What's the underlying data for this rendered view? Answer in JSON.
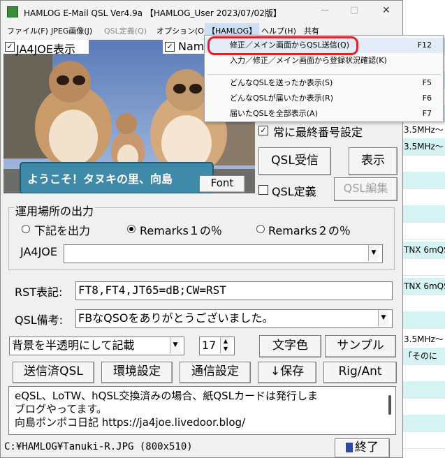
{
  "window": {
    "title": "HAMLOG E-Mail QSL Ver4.9a 【HAMLOG_User 2023/07/02版】",
    "minimize": "—",
    "maximize": "▢",
    "close": "✕"
  },
  "menubar": [
    "ファイル(F)",
    "JPEG画像(J)",
    "QSL定義(Q)",
    "オプション(O)",
    "【HAMLOG】",
    "ヘルプ(H)",
    "共有"
  ],
  "dropdown": {
    "items": [
      {
        "label": "修正／メイン画面からQSL送信(Q)",
        "key": "F12"
      },
      {
        "label": "入力／修正／メイン画面から登録状況確認(K)",
        "key": ""
      },
      {
        "label": "どんなQSLを送ったか表示(S)",
        "key": "F5"
      },
      {
        "label": "どんなQSLが届いたか表示(R)",
        "key": "F6"
      },
      {
        "label": "届いたQSLを全部表示(A)",
        "key": "F7"
      }
    ]
  },
  "image_area": {
    "chk_callsign": "JA4JOE表示",
    "chk_name": "Name",
    "sign_text": "ようこそ！タヌキの里、向島",
    "font_button": "Font"
  },
  "right_panel": {
    "chk_last_number": "常に最終番号設定",
    "btn_receive": "QSL受信",
    "btn_show": "表示",
    "chk_qsl_def": "QSL定義",
    "btn_qsl_edit": "QSL編集"
  },
  "output_group": {
    "title": "運用場所の出力",
    "radio1": "下記を出力",
    "radio2": "Remarks１の％",
    "radio3": "Remarks２の％",
    "call_label": "JA4JOE",
    "call_value": ""
  },
  "rst": {
    "label": "RST表記:",
    "value": "FT8,FT4,JT65=dB;CW=RST"
  },
  "remarks": {
    "label": "QSL備考:",
    "value": "FBなQSOをありがとうございました。"
  },
  "bg_select": {
    "value": "背景を半透明にして記載"
  },
  "font_size": {
    "value": "17"
  },
  "buttons": {
    "char_color": "文字色",
    "sample": "サンプル",
    "sent_qsl": "送信済QSL",
    "env": "環境設定",
    "comm": "通信設定",
    "save": "↓保存",
    "rigant": "Rig/Ant",
    "exit": "終了"
  },
  "memo": {
    "line1": "eQSL、LoTW、hQSL交換済みの場合、紙QSLカードは発行しま",
    "line2": "ブログやってます。",
    "line3": "向島ポンポコ日記 https://ja4joe.livedoor.blog/"
  },
  "status": {
    "path": "C:¥HAMLOG¥Tanuki-R.JPG (800x510)"
  },
  "bg_grid": {
    "rows": [
      "3.5MHz〜",
      "3.5MHz〜",
      "TNX 6mQS",
      "TNX 6mQS",
      "3.5MHz〜",
      "「そのに"
    ]
  }
}
